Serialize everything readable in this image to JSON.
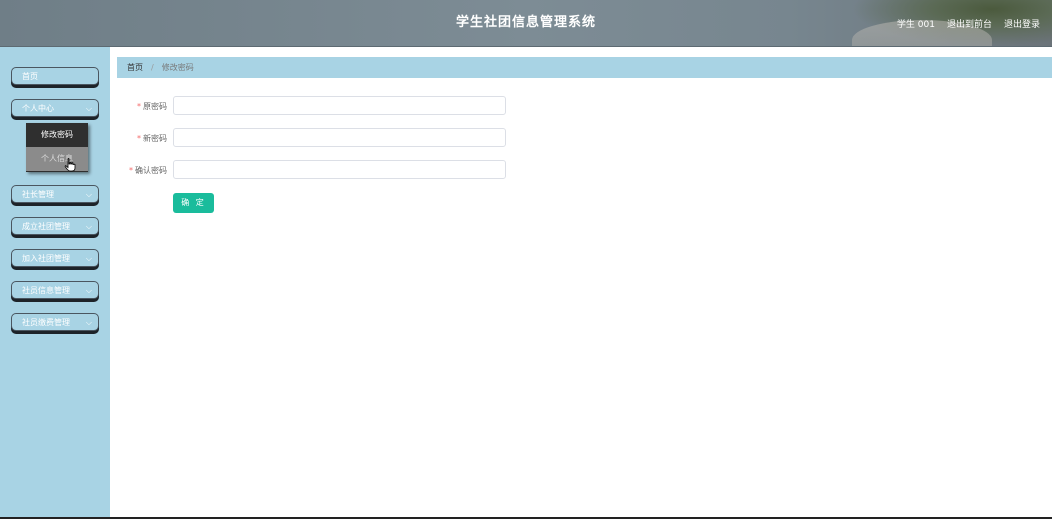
{
  "header": {
    "title": "学生社团信息管理系统",
    "user": "学生 001",
    "link_frontend": "退出到前台",
    "link_logout": "退出登录"
  },
  "sidebar": {
    "items": [
      {
        "label": "首页",
        "has_arrow": false
      },
      {
        "label": "个人中心",
        "has_arrow": true
      },
      {
        "label": "社长管理",
        "has_arrow": true
      },
      {
        "label": "成立社团管理",
        "has_arrow": true
      },
      {
        "label": "加入社团管理",
        "has_arrow": true
      },
      {
        "label": "社员信息管理",
        "has_arrow": true
      },
      {
        "label": "社员缴费管理",
        "has_arrow": true
      }
    ],
    "submenu": [
      "修改密码",
      "个人信息"
    ]
  },
  "breadcrumb": {
    "home": "首页",
    "current": "修改密码"
  },
  "form": {
    "old_password_label": "原密码",
    "new_password_label": "新密码",
    "confirm_password_label": "确认密码",
    "submit_label": "确 定"
  },
  "colors": {
    "accent": "#1abc9c",
    "sidebar_bg": "#a8d3e4",
    "required_star": "#f56c6c"
  }
}
